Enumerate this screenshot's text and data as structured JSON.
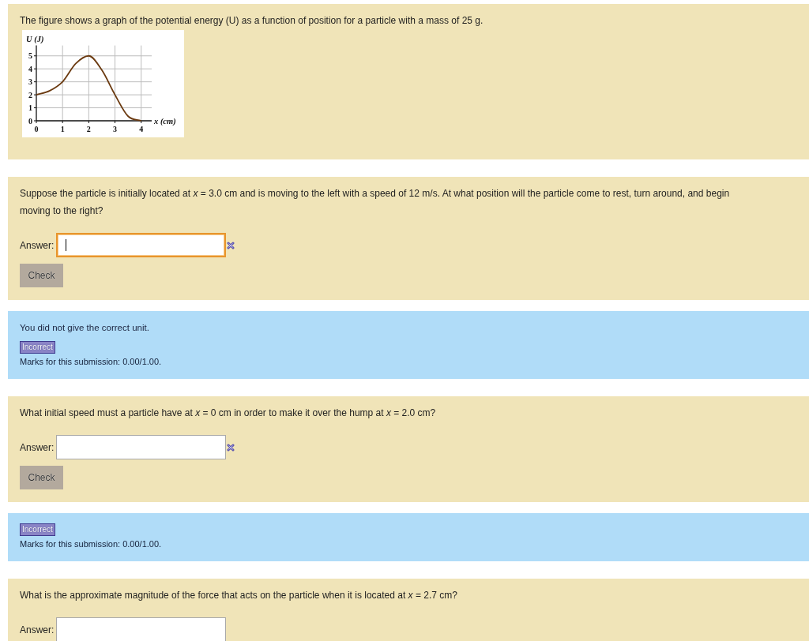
{
  "intro": {
    "text": "The figure shows a graph of the potential energy (U) as a function of position for a particle with a mass of 25 g.",
    "chart_data": {
      "type": "line",
      "xlabel": "x (cm)",
      "ylabel": "U (J)",
      "x": [
        0,
        0.5,
        1,
        1.5,
        2,
        2.5,
        3,
        3.5,
        4
      ],
      "series": [
        {
          "color": "#6b3a10",
          "values": [
            2,
            2.3,
            3,
            4.4,
            5,
            3.9,
            2,
            0.35,
            0
          ]
        }
      ],
      "xlim": [
        0,
        4.4
      ],
      "ylim": [
        0,
        5.8
      ],
      "xticks": [
        0,
        1,
        2,
        3,
        4
      ],
      "yticks": [
        0,
        1,
        2,
        3,
        4,
        5
      ],
      "grid": true
    }
  },
  "questions": [
    {
      "text": "Suppose the particle is initially located at *x* = 3.0 cm and is moving to the left with a speed of 12 m/s. At what position will the particle come to rest, turn around, and begin moving to the right?",
      "answer_label": "Answer:",
      "focused": true,
      "incorrect_mark": true,
      "button": "Check",
      "feedback": {
        "message": "You did not give the correct unit.",
        "status": "Incorrect",
        "marks": "Marks for this submission: 0.00/1.00."
      }
    },
    {
      "text": "What initial speed must a particle have at *x* = 0 cm in order to make it over the hump at *x* = 2.0 cm?",
      "answer_label": "Answer:",
      "focused": false,
      "incorrect_mark": true,
      "button": "Check",
      "feedback": {
        "status": "Incorrect",
        "marks": "Marks for this submission: 0.00/1.00."
      }
    },
    {
      "text": "What is the approximate magnitude of the force that acts on the particle when it is located at *x* = 2.7 cm?",
      "answer_label": "Answer:",
      "focused": false,
      "incorrect_mark": false
    }
  ]
}
